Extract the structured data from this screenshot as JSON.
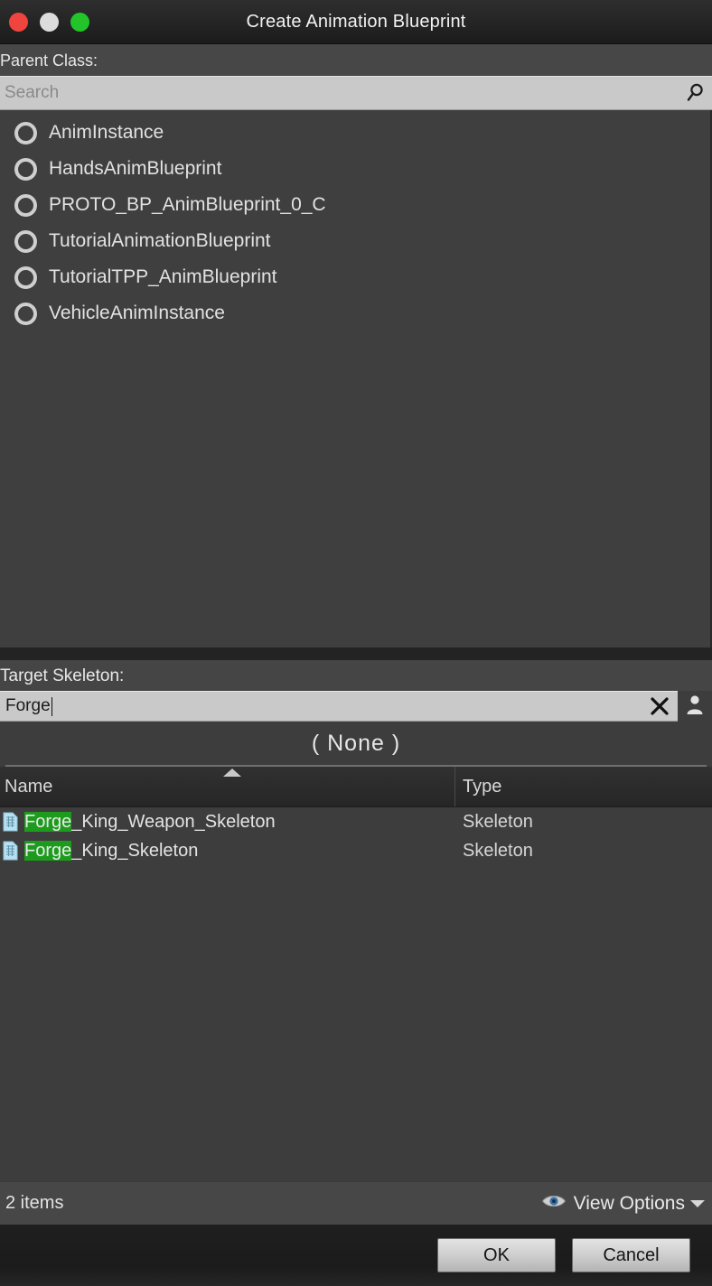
{
  "window": {
    "title": "Create Animation Blueprint",
    "traffic_lights": [
      {
        "name": "close",
        "color": "#f0453f"
      },
      {
        "name": "minimize",
        "color": "#dcdcdc"
      },
      {
        "name": "zoom",
        "color": "#22c42a"
      }
    ]
  },
  "parent_class": {
    "label": "Parent Class:",
    "search": {
      "placeholder": "Search",
      "value": "",
      "icon": "search-icon"
    },
    "items": [
      {
        "label": "AnimInstance",
        "selected": false
      },
      {
        "label": "HandsAnimBlueprint",
        "selected": false
      },
      {
        "label": "PROTO_BP_AnimBlueprint_0_C",
        "selected": false
      },
      {
        "label": "TutorialAnimationBlueprint",
        "selected": false
      },
      {
        "label": "TutorialTPP_AnimBlueprint",
        "selected": false
      },
      {
        "label": "VehicleAnimInstance",
        "selected": false
      }
    ]
  },
  "target_skeleton": {
    "label": "Target Skeleton:",
    "search": {
      "value": "Forge",
      "placeholder": ""
    },
    "clear_icon": "close-icon",
    "picker_icon": "person-icon",
    "selected_value": "( None )",
    "table": {
      "columns": [
        "Name",
        "Type"
      ],
      "sort_column": "Name",
      "sort_direction": "ascending",
      "highlight_term": "Forge",
      "rows": [
        {
          "name": "Forge_King_Weapon_Skeleton",
          "type": "Skeleton",
          "icon": "skeleton-asset-icon"
        },
        {
          "name": "Forge_King_Skeleton",
          "type": "Skeleton",
          "icon": "skeleton-asset-icon"
        }
      ]
    },
    "status": {
      "item_count": "2 items",
      "view_options_label": "View Options",
      "view_options_icon": "eye-icon"
    }
  },
  "footer": {
    "ok_label": "OK",
    "cancel_label": "Cancel"
  },
  "colors": {
    "highlight_green": "#1d9b1d",
    "panel_bg": "#3d3d3d",
    "field_bg": "#c9c9c9"
  }
}
